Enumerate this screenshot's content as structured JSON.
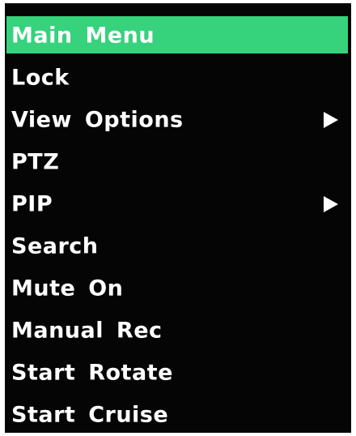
{
  "menu": {
    "items": [
      {
        "label": "Main Menu",
        "selected": true,
        "submenu": false
      },
      {
        "label": "Lock",
        "selected": false,
        "submenu": false
      },
      {
        "label": "View Options",
        "selected": false,
        "submenu": true
      },
      {
        "label": "PTZ",
        "selected": false,
        "submenu": false
      },
      {
        "label": "PIP",
        "selected": false,
        "submenu": true
      },
      {
        "label": "Search",
        "selected": false,
        "submenu": false
      },
      {
        "label": "Mute On",
        "selected": false,
        "submenu": false
      },
      {
        "label": "Manual Rec",
        "selected": false,
        "submenu": false
      },
      {
        "label": "Start Rotate",
        "selected": false,
        "submenu": false
      },
      {
        "label": "Start Cruise",
        "selected": false,
        "submenu": false
      }
    ]
  },
  "colors": {
    "background": "#050505",
    "highlight": "#36d27c",
    "text": "#ffffff"
  },
  "icons": {
    "submenu_arrow": "right-triangle-arrow"
  }
}
